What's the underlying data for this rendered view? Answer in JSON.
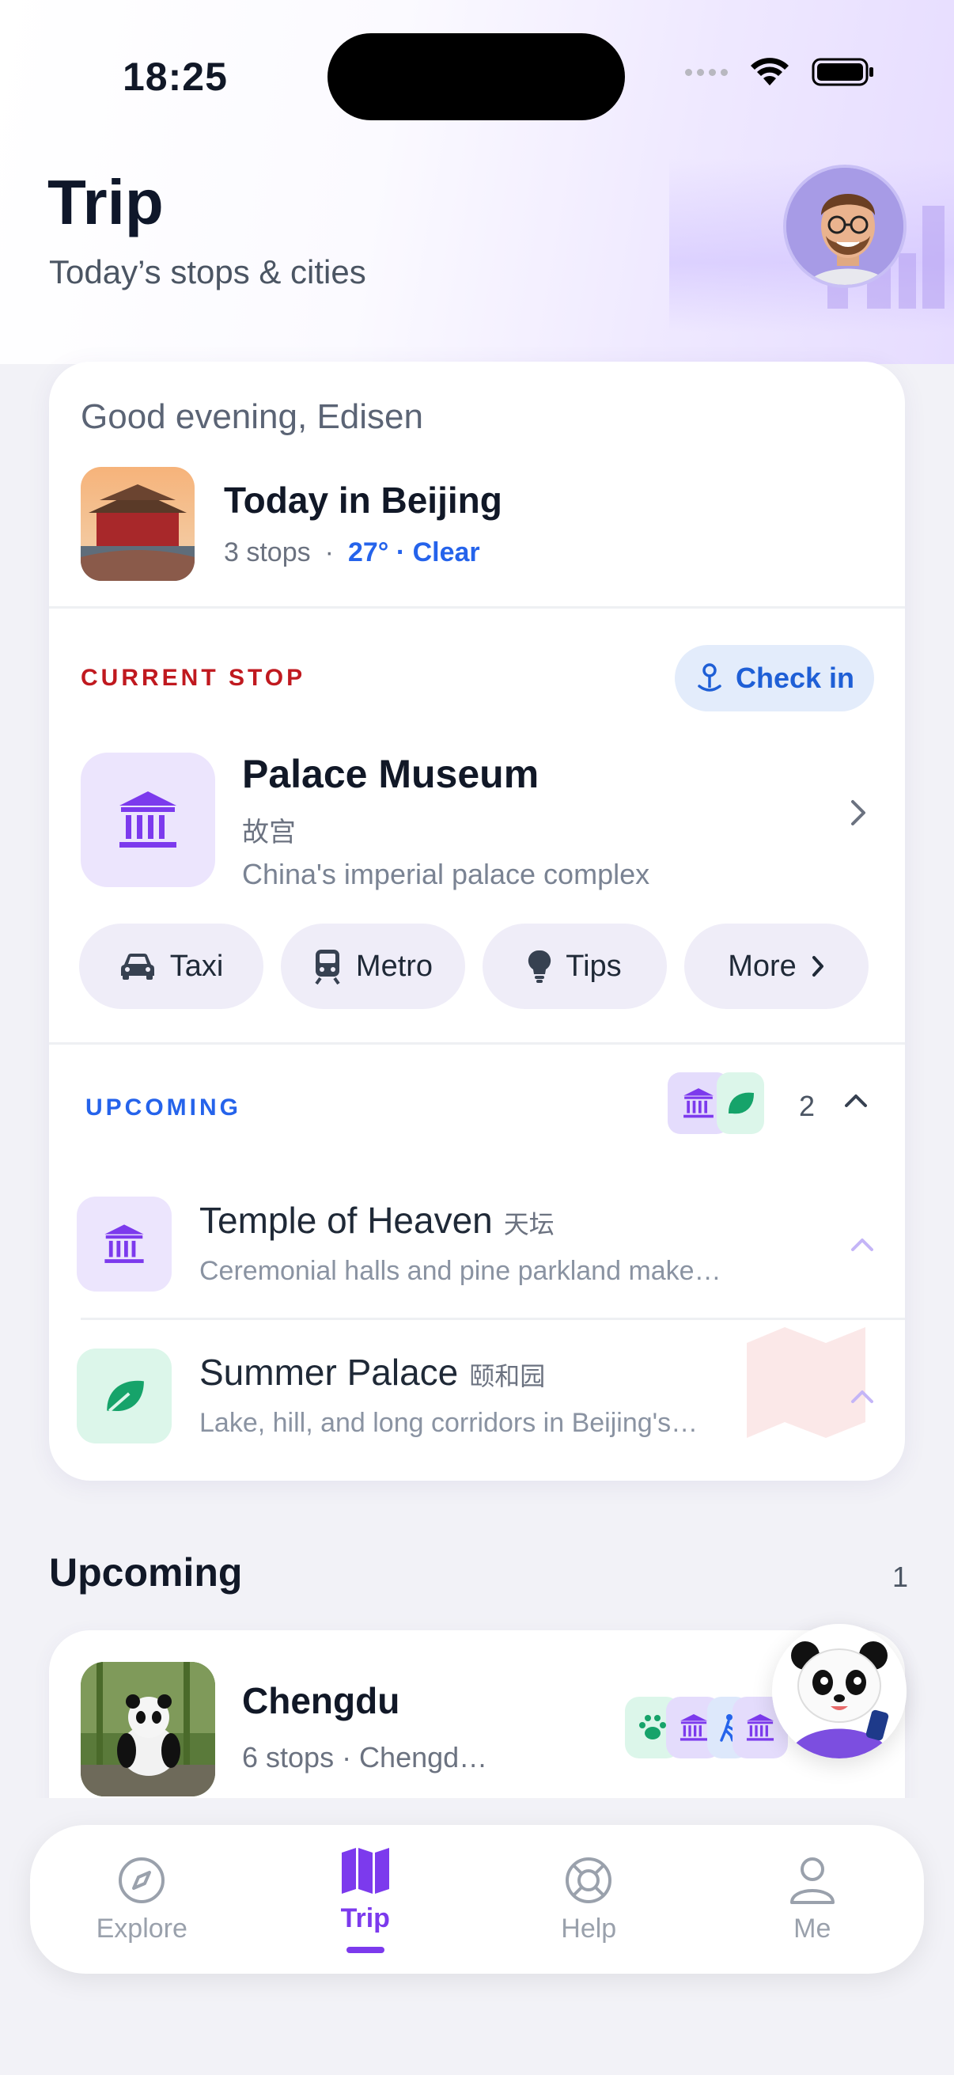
{
  "status_bar": {
    "time": "18:25"
  },
  "header": {
    "title": "Trip",
    "subtitle": "Today’s stops & cities"
  },
  "today_card": {
    "greeting": "Good evening, Edisen",
    "city_title": "Today in Beijing",
    "stops": "3 stops",
    "separator": "·",
    "weather": "27° · Clear"
  },
  "current_stop": {
    "section_label": "CURRENT STOP",
    "check_in_label": "Check in",
    "name": "Palace Museum",
    "name_cn": "故宫",
    "description": "China's imperial palace complex",
    "actions": [
      {
        "label": "Taxi",
        "icon": "car-icon"
      },
      {
        "label": "Metro",
        "icon": "metro-icon"
      },
      {
        "label": "Tips",
        "icon": "lightbulb-icon"
      },
      {
        "label": "More",
        "icon": "chevron-right-icon"
      }
    ]
  },
  "upcoming_stops": {
    "section_label": "UPCOMING",
    "count": "2",
    "items": [
      {
        "title": "Temple of Heaven",
        "title_cn": "天坛",
        "description": "Ceremonial halls and pine parkland make…",
        "icon": "museum-icon"
      },
      {
        "title": "Summer Palace",
        "title_cn": "颐和园",
        "description": "Lake, hill, and long corridors in Beijing's…",
        "icon": "leaf-icon"
      }
    ]
  },
  "upcoming_cities": {
    "title": "Upcoming",
    "count": "1",
    "items": [
      {
        "name": "Chengdu",
        "meta": "6 stops · Chengd…"
      }
    ]
  },
  "tabbar": {
    "tabs": [
      {
        "label": "Explore",
        "icon": "compass-icon",
        "active": false
      },
      {
        "label": "Trip",
        "icon": "map-icon",
        "active": true
      },
      {
        "label": "Help",
        "icon": "lifebuoy-icon",
        "active": false
      },
      {
        "label": "Me",
        "icon": "person-icon",
        "active": false
      }
    ]
  },
  "colors": {
    "accent_purple": "#7c3aed",
    "accent_blue": "#2563eb",
    "current_red": "#c0191f",
    "green": "#16a36a"
  }
}
